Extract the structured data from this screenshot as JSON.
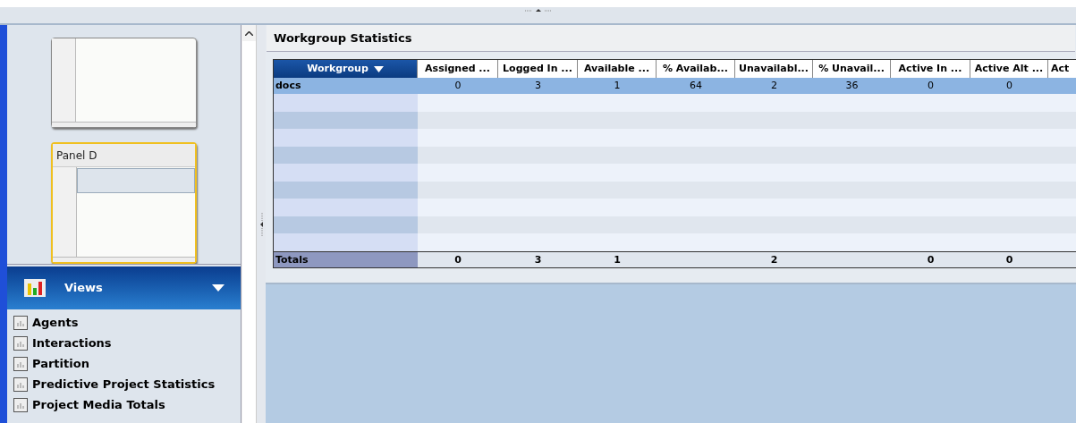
{
  "panels": [
    {
      "selected": false
    },
    {
      "title": "Panel D",
      "selected": true
    }
  ],
  "views": {
    "title": "Views",
    "expanded": true,
    "items": [
      "Agents",
      "Interactions",
      "Partition",
      "Predictive Project Statistics",
      "Project Media Totals"
    ]
  },
  "workgroup_statistics": {
    "title": "Workgroup Statistics",
    "columns": [
      {
        "label": "Workgroup",
        "sorted": true
      },
      {
        "label": "Assigned ...",
        "sorted": false
      },
      {
        "label": "Logged In ...",
        "sorted": false
      },
      {
        "label": "Available ...",
        "sorted": false
      },
      {
        "label": "% Availab...",
        "sorted": false
      },
      {
        "label": "Unavailabl...",
        "sorted": false
      },
      {
        "label": "% Unavail...",
        "sorted": false
      },
      {
        "label": "Active In ...",
        "sorted": false
      },
      {
        "label": "Active Alt ...",
        "sorted": false
      },
      {
        "label": "Act",
        "sorted": false
      }
    ],
    "rows": [
      {
        "selected": true,
        "cells": [
          "docs",
          "0",
          "3",
          "1",
          "64",
          "2",
          "36",
          "0",
          "0"
        ]
      }
    ],
    "totals": [
      {
        "kind": "value",
        "text": "Totals"
      },
      {
        "kind": "value",
        "text": "0"
      },
      {
        "kind": "value",
        "text": "3"
      },
      {
        "kind": "value",
        "text": "1"
      },
      {
        "kind": "blank"
      },
      {
        "kind": "value",
        "text": "2"
      },
      {
        "kind": "blank"
      },
      {
        "kind": "value",
        "text": "0"
      },
      {
        "kind": "value",
        "text": "0"
      }
    ]
  }
}
